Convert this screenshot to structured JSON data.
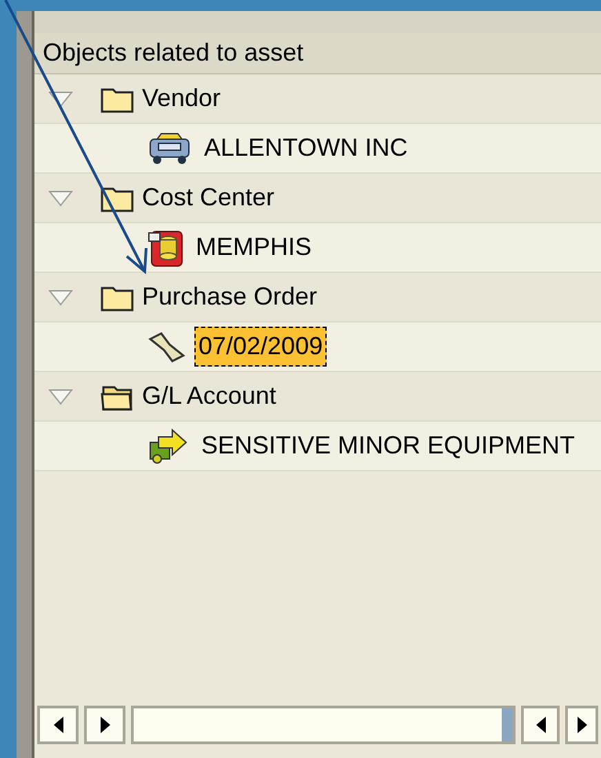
{
  "panel": {
    "title": "Objects related to asset"
  },
  "tree": [
    {
      "label": "Vendor",
      "kind": "folder",
      "expanded": true,
      "children": [
        {
          "label": "ALLENTOWN INC",
          "kind": "vendor",
          "selected": false
        }
      ]
    },
    {
      "label": "Cost Center",
      "kind": "folder",
      "expanded": true,
      "children": [
        {
          "label": "MEMPHIS",
          "kind": "cost-center",
          "selected": false
        }
      ]
    },
    {
      "label": "Purchase Order",
      "kind": "folder",
      "expanded": true,
      "children": [
        {
          "label": "07/02/2009",
          "kind": "document",
          "selected": true
        }
      ]
    },
    {
      "label": "G/L Account",
      "kind": "open-folder",
      "expanded": true,
      "children": [
        {
          "label": "SENSITIVE MINOR EQUIPMENT",
          "kind": "account",
          "selected": false
        }
      ]
    }
  ]
}
